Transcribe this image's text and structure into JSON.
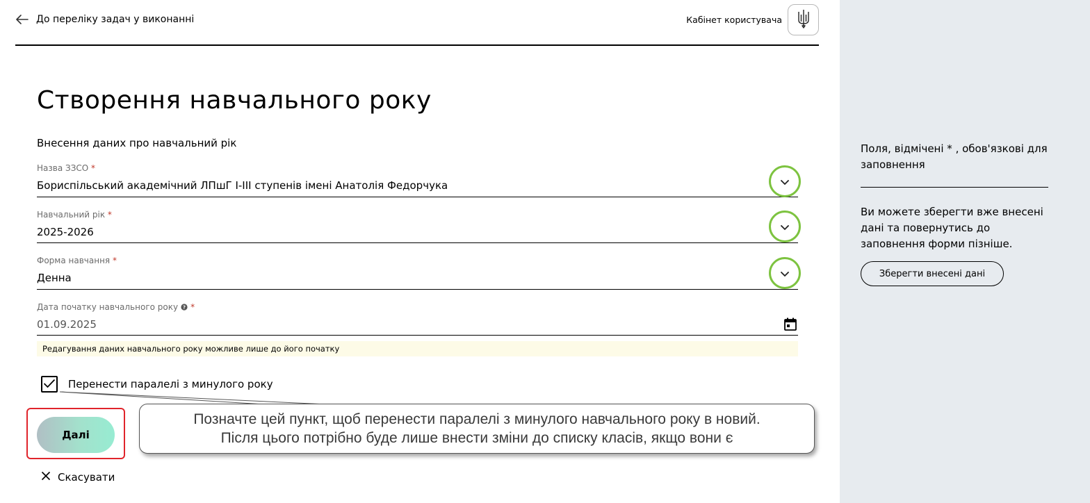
{
  "header": {
    "back_label": "До переліку задач у виконанні",
    "cabinet_label": "Кабінет користувача"
  },
  "page": {
    "title": "Створення навчального року",
    "subtitle": "Внесення даних про навчальний рік"
  },
  "fields": {
    "school": {
      "label": "Назва ЗЗСО",
      "value": "Бориспільський академічний ЛПшГ І-ІІІ ступенів імені Анатолія Федорчука"
    },
    "year": {
      "label": "Навчальний рік",
      "value": "2025-2026"
    },
    "form": {
      "label": "Форма навчання",
      "value": "Денна"
    },
    "start_date": {
      "label": "Дата початку навчального року",
      "value": "01.09.2025"
    }
  },
  "required_mark": "*",
  "notice": "Редагування даних навчального року можливе лише до його початку",
  "checkbox": {
    "label": "Перенести паралелі з минулого року",
    "checked": true
  },
  "buttons": {
    "next": "Далі",
    "cancel": "Скасувати",
    "save": "Зберегти внесені дані"
  },
  "callout": {
    "line1": "Позначте цей пункт, щоб перенести паралелі з минулого навчального року в новий.",
    "line2": "Після цього потрібно буде лише внести зміни до списку класів, якщо вони є"
  },
  "aside": {
    "required_hint": "Поля, відмічені * , обов'язкові для заповнення",
    "save_hint": "Ви можете зберегти вже внесені дані та повернутись до заповнення форми пізніше."
  },
  "colors": {
    "highlight_ring": "#7dc340",
    "highlight_box": "#e0242b",
    "aside_bg": "#e7ebef",
    "notice_bg": "#fdfbe7",
    "required": "#c0392b"
  },
  "icons": {
    "back": "arrow-left-icon",
    "cabinet": "trident-icon",
    "dropdown": "chevron-down-icon",
    "help": "question-circle-icon",
    "date": "calendar-icon",
    "check": "checkmark-icon",
    "cancel": "close-icon"
  }
}
